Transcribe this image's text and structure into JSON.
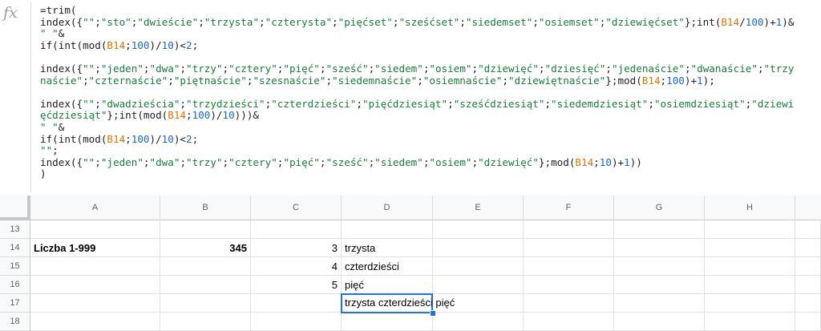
{
  "formula_bar": {
    "icon": "fx",
    "lines": [
      [
        {
          "t": "=trim("
        }
      ],
      [
        {
          "t": "index({"
        },
        {
          "t": "\"\"",
          "c": "s"
        },
        {
          "t": ";"
        },
        {
          "t": "\"sto\"",
          "c": "s"
        },
        {
          "t": ";"
        },
        {
          "t": "\"dwieście\"",
          "c": "s"
        },
        {
          "t": ";"
        },
        {
          "t": "\"trzysta\"",
          "c": "s"
        },
        {
          "t": ";"
        },
        {
          "t": "\"czterysta\"",
          "c": "s"
        },
        {
          "t": ";"
        },
        {
          "t": "\"pięćset\"",
          "c": "s"
        },
        {
          "t": ";"
        },
        {
          "t": "\"sześćset\"",
          "c": "s"
        },
        {
          "t": ";"
        },
        {
          "t": "\"siedemset\"",
          "c": "s"
        },
        {
          "t": ";"
        },
        {
          "t": "\"osiemset\"",
          "c": "s"
        },
        {
          "t": ";"
        },
        {
          "t": "\"dziewięćset\"",
          "c": "s"
        },
        {
          "t": "};int("
        },
        {
          "t": "B14",
          "c": "r"
        },
        {
          "t": "/"
        },
        {
          "t": "100",
          "c": "n"
        },
        {
          "t": ")+"
        },
        {
          "t": "1",
          "c": "n"
        },
        {
          "t": ")&"
        }
      ],
      [
        {
          "t": "\" \"",
          "c": "s"
        },
        {
          "t": "&"
        }
      ],
      [
        {
          "t": "if(int(mod("
        },
        {
          "t": "B14",
          "c": "r"
        },
        {
          "t": ";"
        },
        {
          "t": "100",
          "c": "n"
        },
        {
          "t": ")/"
        },
        {
          "t": "10",
          "c": "n"
        },
        {
          "t": ")<"
        },
        {
          "t": "2",
          "c": "n"
        },
        {
          "t": ";"
        }
      ],
      [
        {
          "t": ""
        }
      ],
      [
        {
          "t": "index({"
        },
        {
          "t": "\"\"",
          "c": "s"
        },
        {
          "t": ";"
        },
        {
          "t": "\"jeden\"",
          "c": "s"
        },
        {
          "t": ";"
        },
        {
          "t": "\"dwa\"",
          "c": "s"
        },
        {
          "t": ";"
        },
        {
          "t": "\"trzy\"",
          "c": "s"
        },
        {
          "t": ";"
        },
        {
          "t": "\"cztery\"",
          "c": "s"
        },
        {
          "t": ";"
        },
        {
          "t": "\"pięć\"",
          "c": "s"
        },
        {
          "t": ";"
        },
        {
          "t": "\"sześć\"",
          "c": "s"
        },
        {
          "t": ";"
        },
        {
          "t": "\"siedem\"",
          "c": "s"
        },
        {
          "t": ";"
        },
        {
          "t": "\"osiem\"",
          "c": "s"
        },
        {
          "t": ";"
        },
        {
          "t": "\"dziewięć\"",
          "c": "s"
        },
        {
          "t": ";"
        },
        {
          "t": "\"dziesięć\"",
          "c": "s"
        },
        {
          "t": ";"
        },
        {
          "t": "\"jedenaście\"",
          "c": "s"
        },
        {
          "t": ";"
        },
        {
          "t": "\"dwanaście\"",
          "c": "s"
        },
        {
          "t": ";"
        },
        {
          "t": "\"trzy",
          "c": "s"
        }
      ],
      [
        {
          "t": "naście\"",
          "c": "s"
        },
        {
          "t": ";"
        },
        {
          "t": "\"czternaście\"",
          "c": "s"
        },
        {
          "t": ";"
        },
        {
          "t": "\"piętnaście\"",
          "c": "s"
        },
        {
          "t": ";"
        },
        {
          "t": "\"szesnaście\"",
          "c": "s"
        },
        {
          "t": ";"
        },
        {
          "t": "\"siedemnaście\"",
          "c": "s"
        },
        {
          "t": ";"
        },
        {
          "t": "\"osiemnaście\"",
          "c": "s"
        },
        {
          "t": ";"
        },
        {
          "t": "\"dziewiętnaście\"",
          "c": "s"
        },
        {
          "t": "};mod("
        },
        {
          "t": "B14",
          "c": "r"
        },
        {
          "t": ";"
        },
        {
          "t": "100",
          "c": "n"
        },
        {
          "t": ")+"
        },
        {
          "t": "1",
          "c": "n"
        },
        {
          "t": ");"
        }
      ],
      [
        {
          "t": ""
        }
      ],
      [
        {
          "t": "index({"
        },
        {
          "t": "\"\"",
          "c": "s"
        },
        {
          "t": ";"
        },
        {
          "t": "\"dwadzieścia\"",
          "c": "s"
        },
        {
          "t": ";"
        },
        {
          "t": "\"trzydzieści\"",
          "c": "s"
        },
        {
          "t": ";"
        },
        {
          "t": "\"czterdzieści\"",
          "c": "s"
        },
        {
          "t": ";"
        },
        {
          "t": "\"pięćdziesiąt\"",
          "c": "s"
        },
        {
          "t": ";"
        },
        {
          "t": "\"sześćdziesiąt\"",
          "c": "s"
        },
        {
          "t": ";"
        },
        {
          "t": "\"siedemdziesiąt\"",
          "c": "s"
        },
        {
          "t": ";"
        },
        {
          "t": "\"osiemdziesiąt\"",
          "c": "s"
        },
        {
          "t": ";"
        },
        {
          "t": "\"dziewi",
          "c": "s"
        }
      ],
      [
        {
          "t": "ęćdziesiąt\"",
          "c": "s"
        },
        {
          "t": "};int(mod("
        },
        {
          "t": "B14",
          "c": "r"
        },
        {
          "t": ";"
        },
        {
          "t": "100",
          "c": "n"
        },
        {
          "t": ")/"
        },
        {
          "t": "10",
          "c": "n"
        },
        {
          "t": ")))&"
        }
      ],
      [
        {
          "t": "\" \"",
          "c": "s"
        },
        {
          "t": "&"
        }
      ],
      [
        {
          "t": "if(int(mod("
        },
        {
          "t": "B14",
          "c": "r"
        },
        {
          "t": ";"
        },
        {
          "t": "100",
          "c": "n"
        },
        {
          "t": ")/"
        },
        {
          "t": "10",
          "c": "n"
        },
        {
          "t": ")<"
        },
        {
          "t": "2",
          "c": "n"
        },
        {
          "t": ";"
        }
      ],
      [
        {
          "t": "\"\"",
          "c": "s"
        },
        {
          "t": ";"
        }
      ],
      [
        {
          "t": "index({"
        },
        {
          "t": "\"\"",
          "c": "s"
        },
        {
          "t": ";"
        },
        {
          "t": "\"jeden\"",
          "c": "s"
        },
        {
          "t": ";"
        },
        {
          "t": "\"dwa\"",
          "c": "s"
        },
        {
          "t": ";"
        },
        {
          "t": "\"trzy\"",
          "c": "s"
        },
        {
          "t": ";"
        },
        {
          "t": "\"cztery\"",
          "c": "s"
        },
        {
          "t": ";"
        },
        {
          "t": "\"pięć\"",
          "c": "s"
        },
        {
          "t": ";"
        },
        {
          "t": "\"sześć\"",
          "c": "s"
        },
        {
          "t": ";"
        },
        {
          "t": "\"siedem\"",
          "c": "s"
        },
        {
          "t": ";"
        },
        {
          "t": "\"osiem\"",
          "c": "s"
        },
        {
          "t": ";"
        },
        {
          "t": "\"dziewięć\"",
          "c": "s"
        },
        {
          "t": "};mod("
        },
        {
          "t": "B14",
          "c": "r"
        },
        {
          "t": ";"
        },
        {
          "t": "10",
          "c": "n"
        },
        {
          "t": ")+"
        },
        {
          "t": "1",
          "c": "n"
        },
        {
          "t": "))"
        }
      ],
      [
        {
          "t": ")"
        }
      ]
    ]
  },
  "columns": [
    "A",
    "B",
    "C",
    "D",
    "E",
    "F",
    "G",
    "H"
  ],
  "rows": [
    "13",
    "14",
    "15",
    "16",
    "17",
    "18"
  ],
  "cells": {
    "A14": "Liczba 1-999",
    "B14": "345",
    "C14": "3",
    "D14": "trzysta",
    "C15": "4",
    "D15": "czterdzieści",
    "C16": "5",
    "D16": "pięć",
    "D17": "trzysta czterdzieści pięć"
  },
  "colors": {
    "string": "#188038",
    "number": "#1967d2",
    "reference": "#e37400",
    "selection": "#1a73e8"
  }
}
